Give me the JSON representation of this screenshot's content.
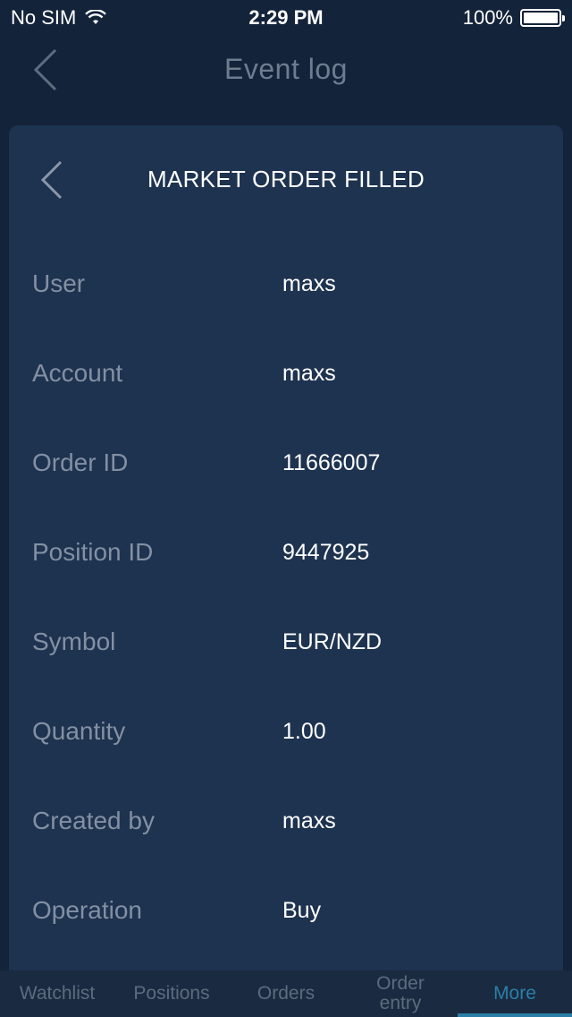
{
  "status_bar": {
    "carrier": "No SIM",
    "time": "2:29 PM",
    "battery": "100%",
    "icons": [
      "wifi-icon",
      "battery-icon"
    ]
  },
  "nav": {
    "title": "Event log",
    "back_icon": "chevron-left-icon"
  },
  "modal": {
    "title": "MARKET ORDER FILLED",
    "back_icon": "chevron-left-icon",
    "rows": [
      {
        "label": "User",
        "value": "maxs"
      },
      {
        "label": "Account",
        "value": "maxs"
      },
      {
        "label": "Order ID",
        "value": "11666007"
      },
      {
        "label": "Position ID",
        "value": "9447925"
      },
      {
        "label": "Symbol",
        "value": "EUR/NZD"
      },
      {
        "label": "Quantity",
        "value": "1.00"
      },
      {
        "label": "Created by",
        "value": "maxs"
      },
      {
        "label": "Operation",
        "value": "Buy"
      }
    ]
  },
  "tab_bar": {
    "tabs": [
      {
        "label": "Watchlist",
        "active": false
      },
      {
        "label": "Positions",
        "active": false
      },
      {
        "label": "Orders",
        "active": false
      },
      {
        "label": "Order entry",
        "active": false
      },
      {
        "label": "More",
        "active": true
      }
    ]
  },
  "colors": {
    "background": "#13233a",
    "card": "#1e3350",
    "label": "#8390a3",
    "accent": "#2b7fa7"
  }
}
